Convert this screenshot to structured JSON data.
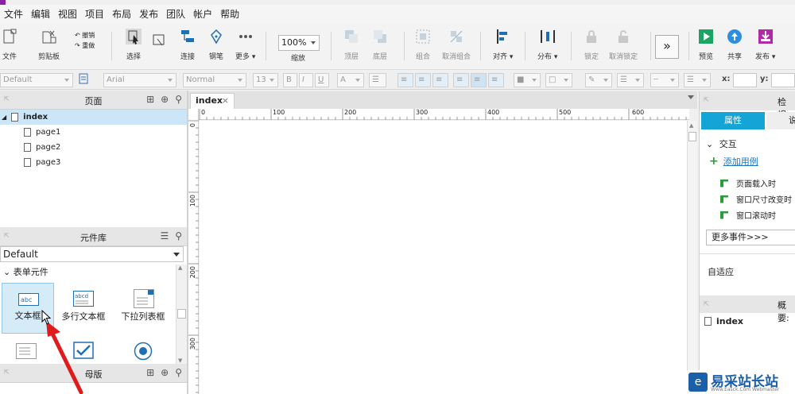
{
  "menu": [
    "文件",
    "编辑",
    "视图",
    "项目",
    "布局",
    "发布",
    "团队",
    "帐户",
    "帮助"
  ],
  "toolbar": {
    "file": "文件",
    "clipboard": "剪贴板",
    "undo": "撤销",
    "redo": "重做",
    "select": "选择",
    "connect": "连接",
    "pen": "钢笔",
    "more": "更多 ▾",
    "zoom_value": "100%",
    "zoom_label": "缩放",
    "top": "顶层",
    "bottom": "底层",
    "group": "组合",
    "ungroup": "取消组合",
    "align": "对齐 ▾",
    "distribute": "分布 ▾",
    "lock": "锁定",
    "unlock": "取消锁定",
    "preview": "预览",
    "share": "共享",
    "publish": "发布 ▾",
    "expand": "»"
  },
  "formatbar": {
    "style": "Default",
    "font": "Arial",
    "weight": "Normal",
    "size": "13",
    "x_label": "x:",
    "y_label": "y:"
  },
  "pages_panel": {
    "title": "页面",
    "root": "index",
    "children": [
      "page1",
      "page2",
      "page3"
    ]
  },
  "library_panel": {
    "title": "元件库",
    "selected": "Default",
    "category": "表单元件",
    "widgets": [
      "文本框",
      "多行文本框",
      "下拉列表框"
    ],
    "widget_icon_text": [
      "abc",
      "abcd"
    ]
  },
  "masters_panel": {
    "title": "母版"
  },
  "canvas": {
    "tab": "index",
    "ruler_top": [
      "0",
      "100",
      "200",
      "300",
      "400",
      "500",
      "600"
    ],
    "ruler_left": [
      "0",
      "100",
      "200",
      "300"
    ]
  },
  "inspector": {
    "title": "检视:",
    "tab_properties": "属性",
    "tab_notes": "说",
    "interaction_header": "交互",
    "add_case": "添加用例",
    "events": [
      "页面载入时",
      "窗口尺寸改变时",
      "窗口滚动时"
    ],
    "more_events": "更多事件>>>",
    "adaptive": "自适应",
    "overview_title": "概要:",
    "overview_item": "index"
  },
  "watermark": {
    "text": "易采站长站",
    "sub": "Www.Easck.Com  Webmaster"
  },
  "colors": {
    "accent": "#8b1fa3",
    "selected_tab": "#14a4d6",
    "arrow": "#e01b1b",
    "event_icon": "#2d9a3b",
    "preview": "#1da363",
    "share": "#2d8ee0",
    "publish": "#b02aa8"
  }
}
